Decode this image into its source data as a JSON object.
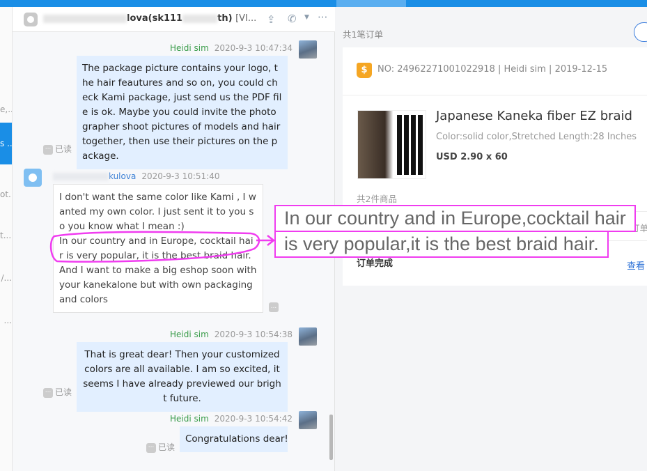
{
  "sidebar": {
    "items": [
      {
        "label": "e,..."
      },
      {
        "label": "s ...",
        "selected": true
      },
      {
        "label": "ot..."
      },
      {
        "label": "t...."
      },
      {
        "label": "/..."
      },
      {
        "label": "..."
      }
    ]
  },
  "chat": {
    "header": {
      "title_visible_middle": "lova(sk111",
      "title_visible_end": "th)",
      "tag": "[VI..."
    },
    "messages": [
      {
        "sender": "Heidi sim",
        "time": "2020-9-3 10:47:34",
        "text": "The package picture contains your logo, the hair feautures and so on, you could check Kami package, just send us the PDF file is ok. Maybe you could invite the photographer shoot pictures of models and hair together, then use their pictures on the package.",
        "status": "已读"
      },
      {
        "sender": "kulova",
        "time": "2020-9-3 10:51:40",
        "text": "I don't want the same color like Kami , I wanted my own color. I just sent it to you so you know what I mean :)\nIn our country and in Europe, cocktail hair is very popular, it is the best braid hair. And I want to make a big eshop soon with your kanekalone but with own packaging and colors"
      },
      {
        "sender": "Heidi sim",
        "time": "2020-9-3 10:54:38",
        "text": "That is great dear! Then your customized colors are all available. I am so excited, it seems I have already previewed our bright future.",
        "status": "已读"
      },
      {
        "sender": "Heidi sim",
        "time": "2020-9-3 10:54:42",
        "text": "Congratulations dear!",
        "status": "已读"
      }
    ],
    "more_label": "..."
  },
  "annotation": {
    "line1": "In our country and in Europe,cocktail hair",
    "line2": "is very popular,it is the best braid hair.",
    "color": "#f03cf0"
  },
  "orders": {
    "count_label": "共1笔订单",
    "order": {
      "header": "NO: 24962271001022918 | Heidi sim | 2019-12-15",
      "product_title": "Japanese Kaneka fiber EZ braid",
      "product_spec": "Color:solid color,Stretched Length:28 Inches",
      "price": "USD 2.90 x 60",
      "items_count": "共2件商品",
      "partial_label": "订单",
      "status": "订单完成",
      "view_link": "查看"
    }
  }
}
